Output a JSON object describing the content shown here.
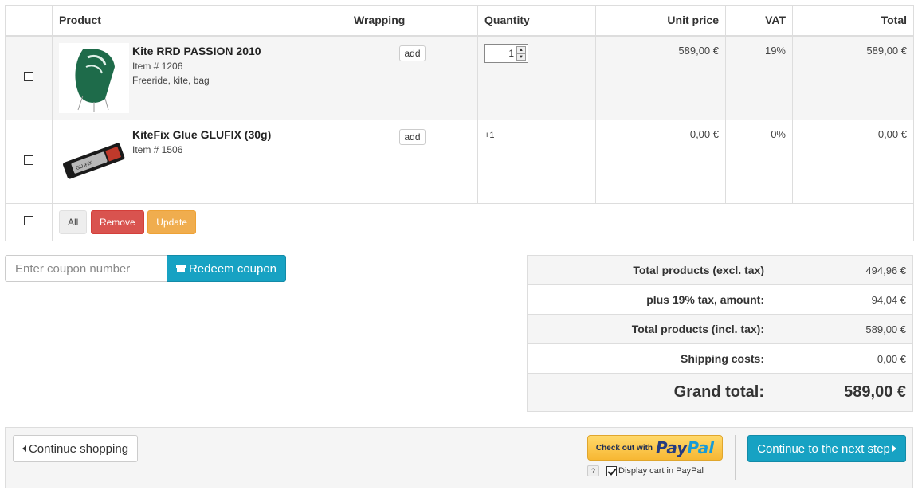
{
  "table": {
    "headers": {
      "select": "",
      "product": "Product",
      "wrapping": "Wrapping",
      "quantity": "Quantity",
      "unit_price": "Unit price",
      "vat": "VAT",
      "total": "Total"
    },
    "items": [
      {
        "name": "Kite RRD PASSION 2010",
        "item_no": "Item # 1206",
        "tags": "Freeride, kite, bag",
        "wrapping_label": "add",
        "quantity": "1",
        "unit_price": "589,00 €",
        "vat": "19%",
        "total": "589,00 €",
        "thumb_color": "#1e6b4a"
      },
      {
        "name": "KiteFix Glue GLUFIX (30g)",
        "item_no": "Item # 1506",
        "tags": "",
        "wrapping_label": "add",
        "quantity": "+1",
        "unit_price": "0,00 €",
        "vat": "0%",
        "total": "0,00 €",
        "thumb_color": "#222222"
      }
    ],
    "actions": {
      "all": "All",
      "remove": "Remove",
      "update": "Update"
    }
  },
  "coupon": {
    "placeholder": "Enter coupon number",
    "button": "Redeem coupon"
  },
  "totals": {
    "rows": [
      {
        "label": "Total products (excl. tax)",
        "value": "494,96 €"
      },
      {
        "label": "plus 19% tax, amount:",
        "value": "94,04 €"
      },
      {
        "label": "Total products (incl. tax):",
        "value": "589,00 €"
      },
      {
        "label": "Shipping costs:",
        "value": "0,00 €"
      },
      {
        "label": "Grand total:",
        "value": "589,00 €"
      }
    ]
  },
  "footer": {
    "continue_shopping": "Continue shopping",
    "paypal_checkout": "Check out with",
    "paypal_pay": "Pay",
    "paypal_pal": "Pal",
    "paypal_help": "?",
    "paypal_display_cart": "Display cart in PayPal",
    "next_step": "Continue to the next step"
  },
  "colors": {
    "accent": "#17a2c3",
    "danger": "#d9534f",
    "warning": "#f0ad4e",
    "paypal_yellow": "#ffc439"
  }
}
